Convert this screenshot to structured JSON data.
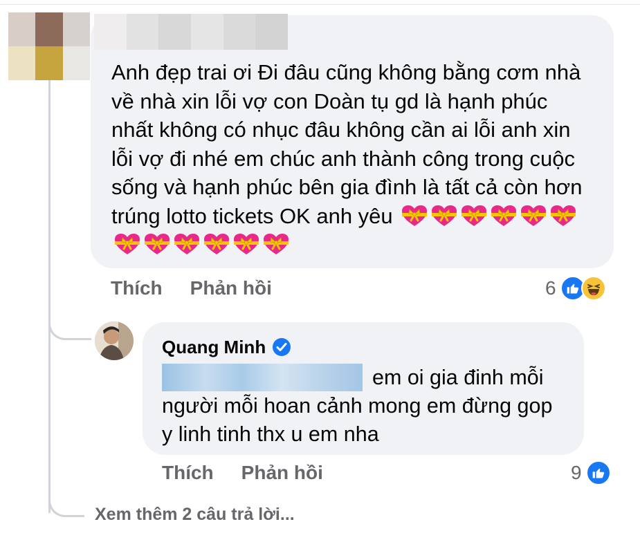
{
  "comment": {
    "text": "Anh đẹp trai ơi Đi đâu cũng không bằng cơm nhà về nhà xin lỗi vợ con Doàn tụ gd là hạnh phúc nhất không có nhục đâu không cần ai lỗi anh xin lỗi vợ đi nhé em chúc anh thành công trong cuộc sống và hạnh phúc bên gia đình là tất cả còn hơn trúng lotto tickets OK anh yêu",
    "emoji_icon": "heart-with-ribbon-icon",
    "emoji_count": 12,
    "actions": {
      "like": "Thích",
      "reply": "Phản hồi"
    },
    "reaction_count": "6",
    "reaction_icons": [
      "like-icon",
      "haha-icon"
    ]
  },
  "reply": {
    "author": "Quang Minh",
    "verified_icon": "verified-badge-icon",
    "text": "em oi gia đinh mỗi người mỗi hoan cảnh mong em đừng gop y linh tinh thx u em nha",
    "actions": {
      "like": "Thích",
      "reply": "Phản hồi"
    },
    "reaction_count": "9",
    "reaction_icons": [
      "like-icon"
    ]
  },
  "view_more": "Xem thêm 2 câu trả lời...",
  "colors": {
    "bubble": "#f0f2f5",
    "muted_text": "#65676b",
    "primary_text": "#050505",
    "like_blue": "#1877f2",
    "haha_yellow": "#f7c33b",
    "thread_line": "#d0d3d8"
  }
}
